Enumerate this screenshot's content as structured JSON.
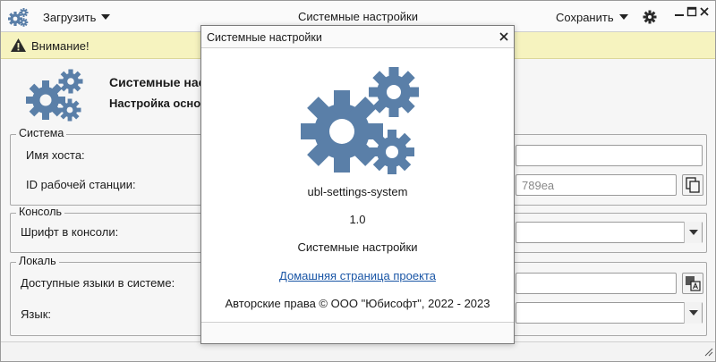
{
  "header": {
    "load_label": "Загрузить",
    "title": "Системные настройки",
    "save_label": "Сохранить"
  },
  "warning": {
    "text": "Внимание!"
  },
  "page": {
    "title": "Системные нас",
    "subtitle": "Настройка осно"
  },
  "groups": {
    "system": {
      "legend": "Система",
      "hostname_label": "Имя хоста:",
      "hostname_value": "",
      "workstation_id_label": "ID рабочей станции:",
      "workstation_id_value": "789ea"
    },
    "console": {
      "legend": "Консоль",
      "font_label": "Шрифт в консоли:",
      "font_value": ""
    },
    "locale": {
      "legend": "Локаль",
      "languages_label": "Доступные языки в системе:",
      "languages_value": "",
      "language_label": "Язык:",
      "language_value": ""
    }
  },
  "about": {
    "title": "Системные настройки",
    "app_name": "ubl-settings-system",
    "version": "1.0",
    "description": "Системные настройки",
    "homepage_link": "Домашняя страница проекта",
    "copyright": "Авторские права © ООО \"Юбисофт\", 2022 - 2023"
  },
  "colors": {
    "gear_blue": "#5a7fa8",
    "warning_bg": "#f6f3bf",
    "link": "#1a56a6"
  },
  "icons": {
    "app": "gears-icon",
    "settings": "gear-icon",
    "warning": "warning-triangle-icon",
    "copy": "copy-icon",
    "translate": "translate-icon"
  }
}
